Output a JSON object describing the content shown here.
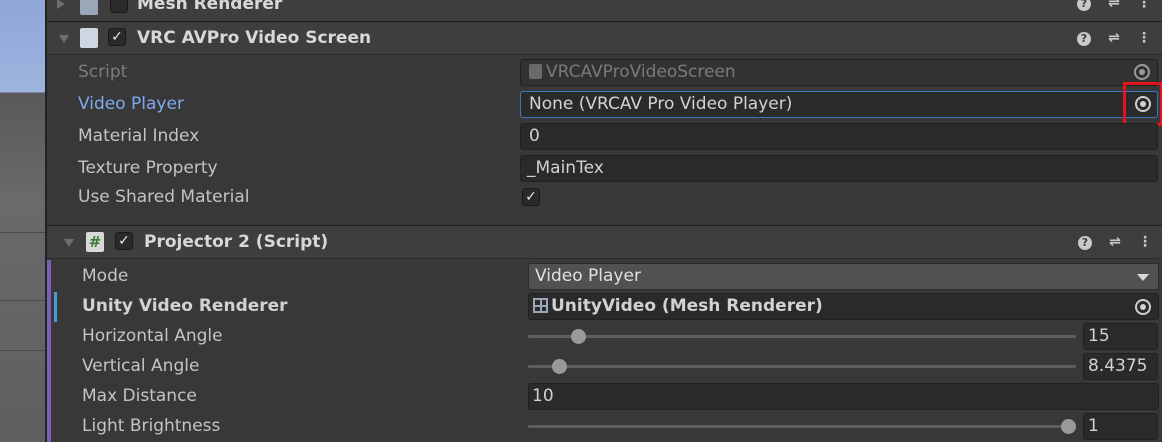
{
  "mesh_renderer": {
    "title": "Mesh Renderer"
  },
  "vrc_screen": {
    "title": "VRC AVPro Video Screen",
    "fields": {
      "script_label": "Script",
      "script_value": "VRCAVProVideoScreen",
      "video_player_label": "Video Player",
      "video_player_value": "None (VRCAV Pro Video Player)",
      "material_index_label": "Material Index",
      "material_index_value": "0",
      "texture_property_label": "Texture Property",
      "texture_property_value": "_MainTex",
      "use_shared_material_label": "Use Shared Material",
      "use_shared_material_checked": "✓"
    }
  },
  "projector": {
    "title": "Projector 2 (Script)",
    "fields": {
      "mode_label": "Mode",
      "mode_value": "Video Player",
      "unity_video_renderer_label": "Unity Video Renderer",
      "unity_video_renderer_value": "UnityVideo (Mesh Renderer)",
      "horizontal_angle_label": "Horizontal Angle",
      "horizontal_angle_value": "15",
      "vertical_angle_label": "Vertical Angle",
      "vertical_angle_value": "8.4375",
      "max_distance_label": "Max Distance",
      "max_distance_value": "10",
      "light_brightness_label": "Light Brightness",
      "light_brightness_value": "1"
    }
  },
  "icons": {
    "help": "?",
    "presets": "⇌",
    "menu": "⋮",
    "check": "✓",
    "hash": "#"
  },
  "colors": {
    "highlight": "#e1131c",
    "label_blue": "#7fa9ee",
    "focus_border": "#3a79bb"
  }
}
